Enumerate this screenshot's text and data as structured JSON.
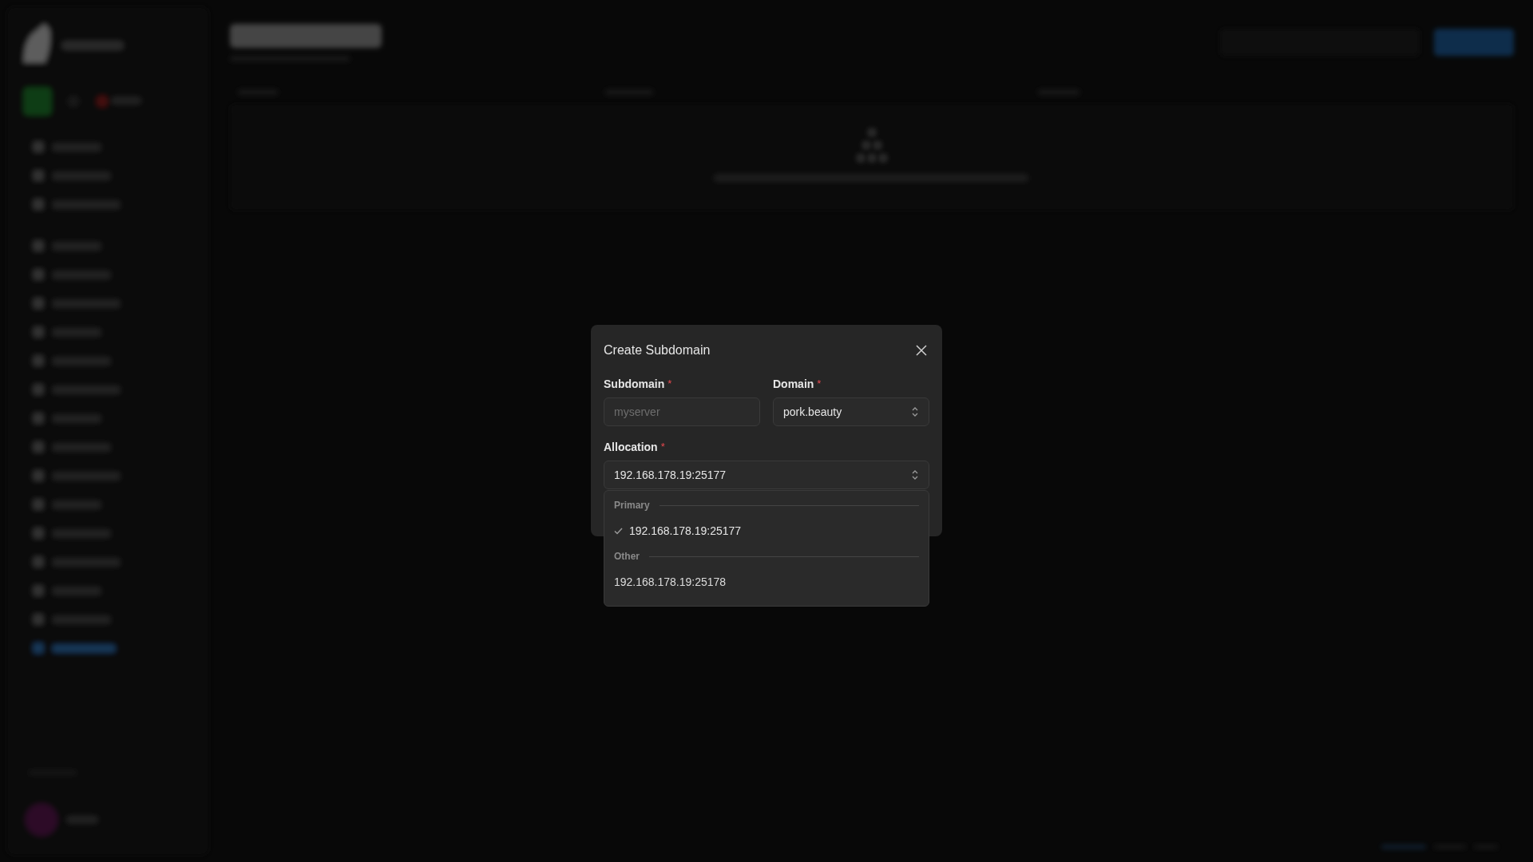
{
  "dialog": {
    "title": "Create Subdomain",
    "fields": [
      {
        "kind": "input",
        "label": "Subdomain",
        "required_mark": "*",
        "placeholder": "myserver"
      },
      {
        "kind": "select",
        "label": "Domain",
        "required_mark": "*",
        "value": "pork.beauty"
      }
    ],
    "allocation": {
      "label": "Allocation",
      "required_mark": "*",
      "value": "192.168.178.19:25177"
    }
  },
  "dropdown": {
    "groups": [
      {
        "label": "Primary",
        "options": [
          {
            "label": "192.168.178.19:25177",
            "selected": true
          }
        ]
      },
      {
        "label": "Other",
        "options": [
          {
            "label": "192.168.178.19:25178",
            "selected": false
          }
        ]
      }
    ]
  }
}
